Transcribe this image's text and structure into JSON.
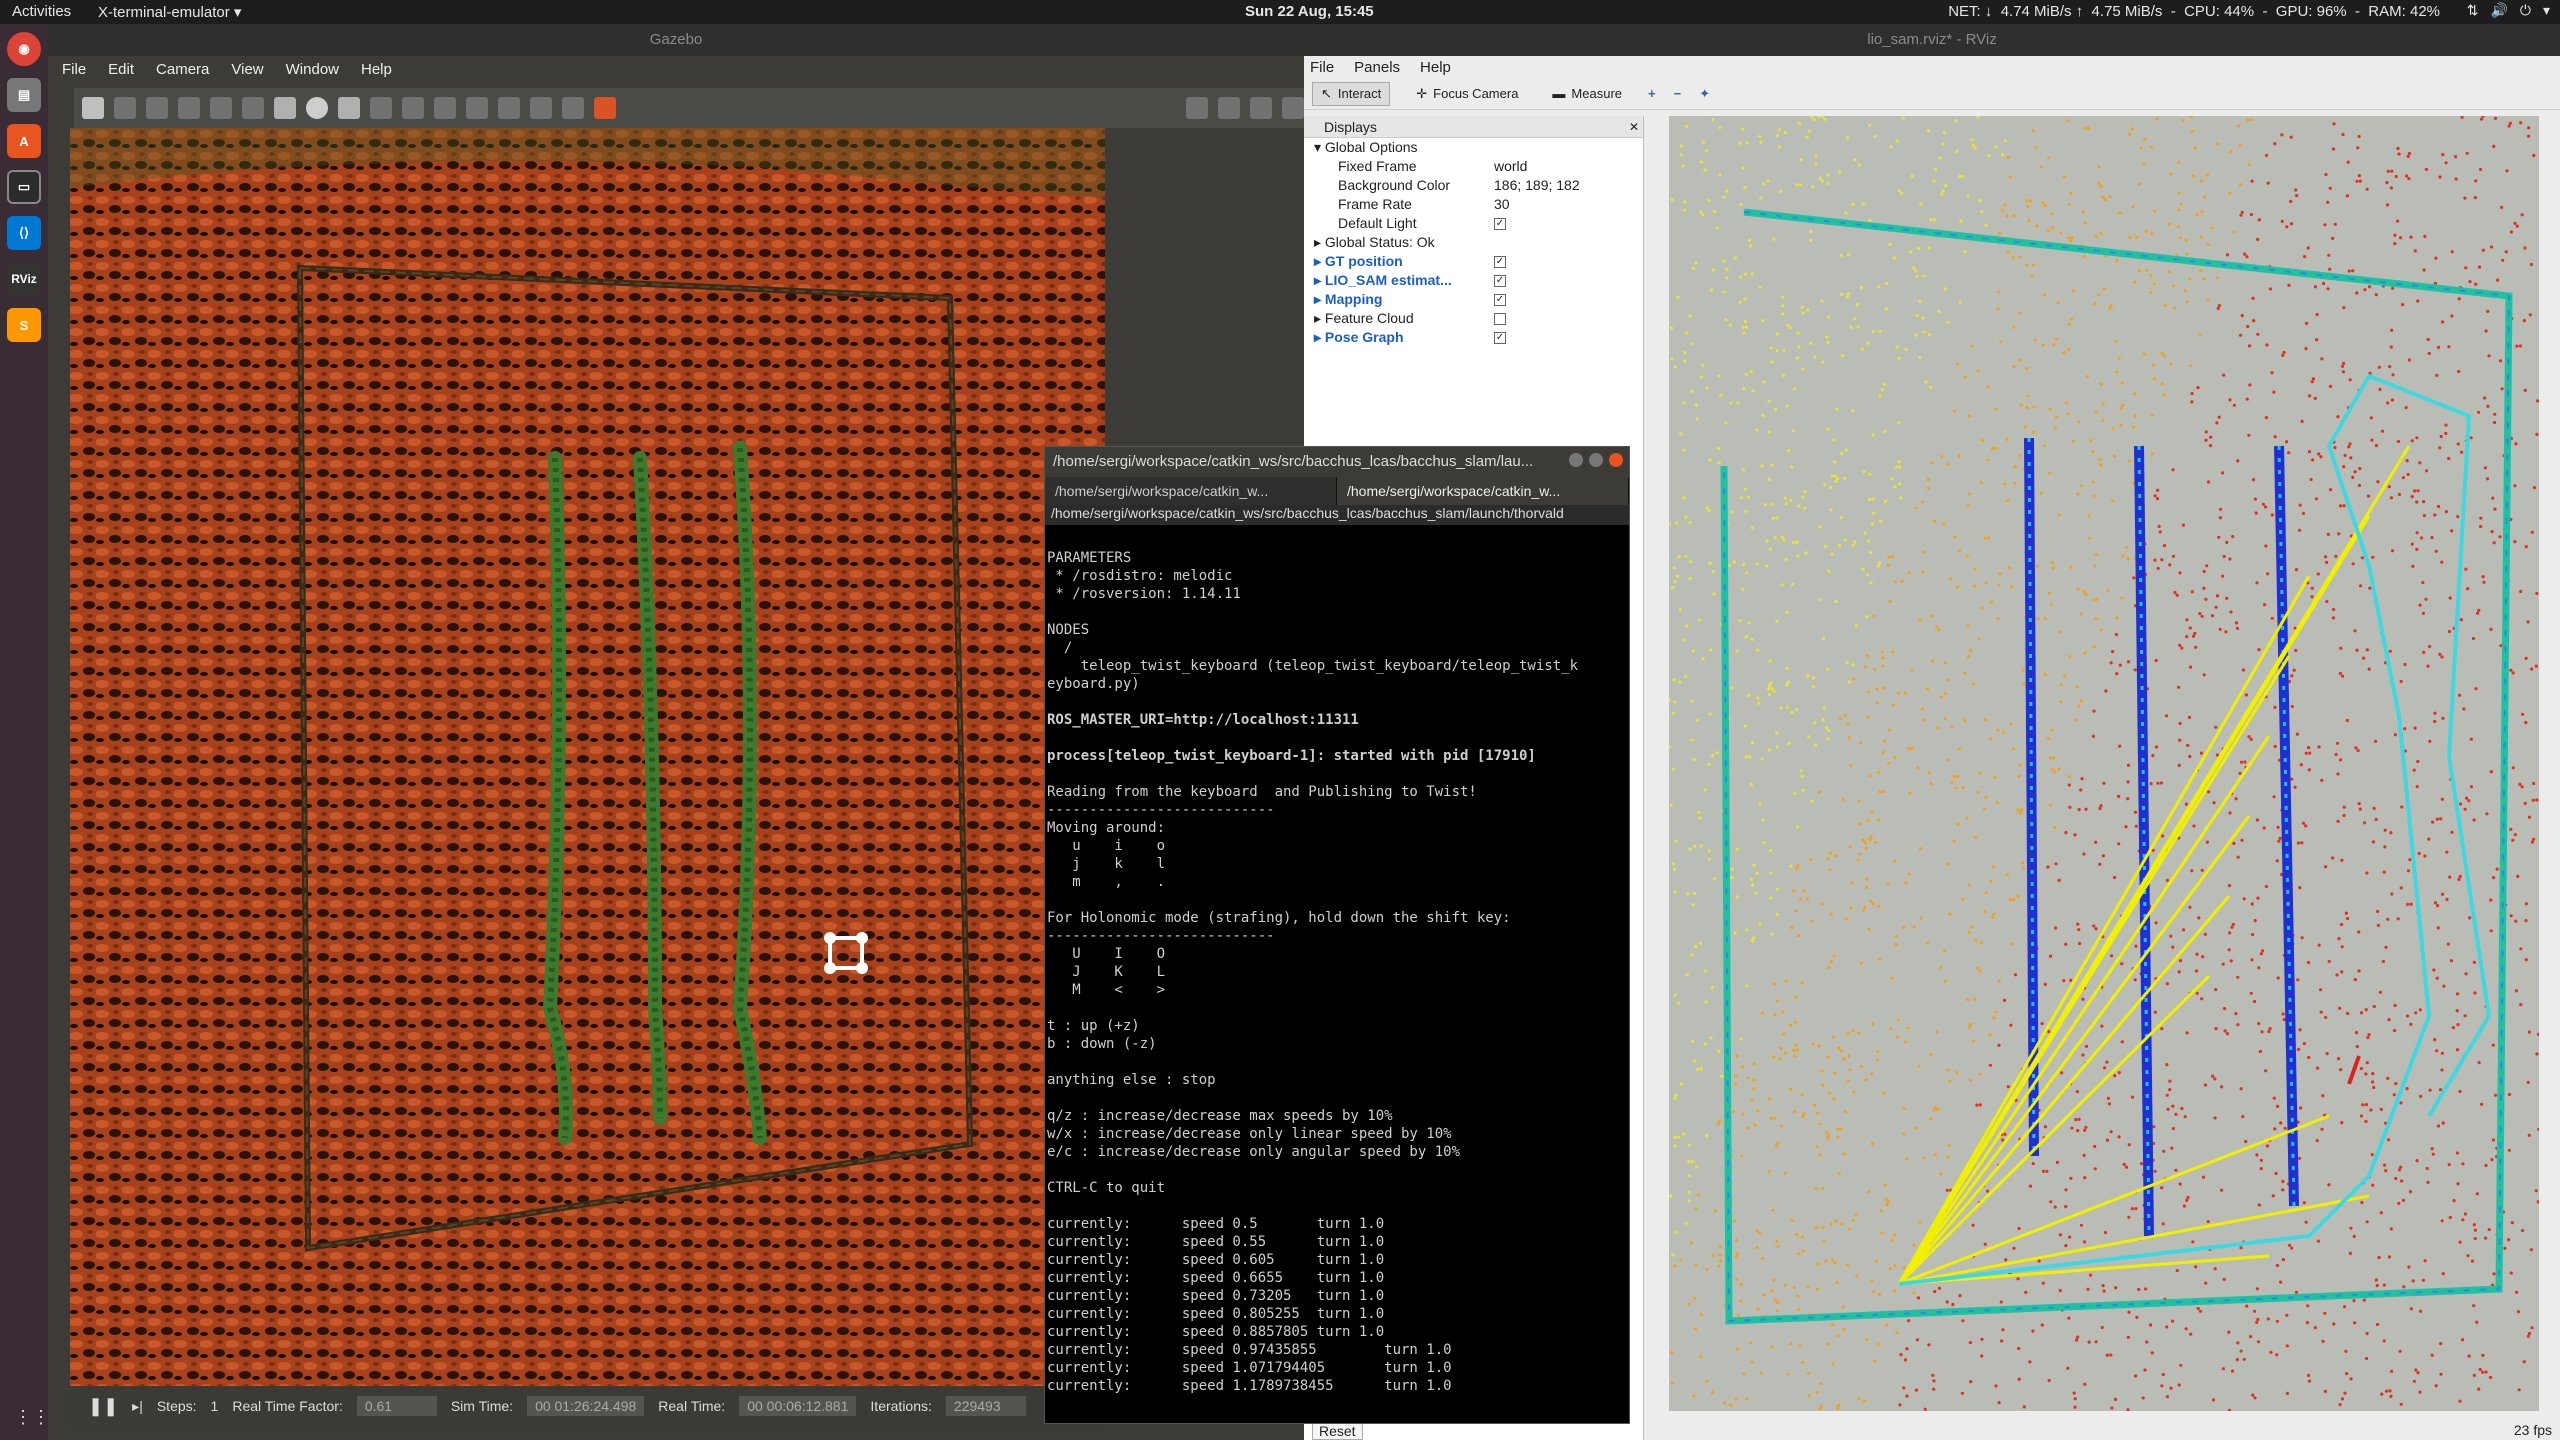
{
  "topbar": {
    "activities": "Activities",
    "app": "X-terminal-emulator ▾",
    "clock": "Sun 22 Aug, 15:45",
    "stats": "NET: ↓  4.74 MiB/s ↑  4.75 MiB/s  -  CPU: 44%  -  GPU: 96%  -  RAM: 42%"
  },
  "dock": {
    "items": [
      "Chrome",
      "Files",
      "Software",
      "Terminal",
      "VS Code",
      "RViz",
      "Sublime"
    ]
  },
  "gazebo": {
    "title": "Gazebo",
    "menu": [
      "File",
      "Edit",
      "Camera",
      "View",
      "Window",
      "Help"
    ],
    "status": {
      "steps_label": "Steps:",
      "steps": "1",
      "rtf_label": "Real Time Factor:",
      "rtf": "0.61",
      "sim_label": "Sim Time:",
      "sim": "00 01:26:24.498",
      "real_label": "Real Time:",
      "real": "00 00:06:12.881",
      "iter_label": "Iterations:",
      "iter": "229493"
    }
  },
  "rviz": {
    "title": "lio_sam.rviz* - RViz",
    "menu": [
      "File",
      "Panels",
      "Help"
    ],
    "tools": [
      "Interact",
      "Focus Camera",
      "Measure"
    ],
    "displays_title": "Displays",
    "props": [
      {
        "name": "Global Options",
        "value": ""
      },
      {
        "name": "Fixed Frame",
        "value": "world"
      },
      {
        "name": "Background Color",
        "value": "186; 189; 182"
      },
      {
        "name": "Frame Rate",
        "value": "30"
      },
      {
        "name": "Default Light",
        "value": "✓"
      },
      {
        "name": "Global Status: Ok",
        "value": ""
      },
      {
        "name": "GT position",
        "value": "✓"
      },
      {
        "name": "LIO_SAM estimat...",
        "value": "✓"
      },
      {
        "name": "Mapping",
        "value": "✓"
      },
      {
        "name": "Feature Cloud",
        "value": ""
      },
      {
        "name": "Pose Graph",
        "value": "✓"
      }
    ],
    "reset": "Reset",
    "fps": "23 fps",
    "bg_color": "#babdb6"
  },
  "terminal": {
    "title": "/home/sergi/workspace/catkin_ws/src/bacchus_lcas/bacchus_slam/lau...",
    "tabs": [
      "/home/sergi/workspace/catkin_w...",
      "/home/sergi/workspace/catkin_w..."
    ],
    "path": "/home/sergi/workspace/catkin_ws/src/bacchus_lcas/bacchus_slam/launch/thorvald",
    "lines": [
      "",
      "PARAMETERS",
      " * /rosdistro: melodic",
      " * /rosversion: 1.14.11",
      "",
      "NODES",
      "  /",
      "    teleop_twist_keyboard (teleop_twist_keyboard/teleop_twist_k",
      "eyboard.py)",
      "",
      "ROS_MASTER_URI=http://localhost:11311",
      "",
      "process[teleop_twist_keyboard-1]: started with pid [17910]",
      "",
      "Reading from the keyboard  and Publishing to Twist!",
      "---------------------------",
      "Moving around:",
      "   u    i    o",
      "   j    k    l",
      "   m    ,    .",
      "",
      "For Holonomic mode (strafing), hold down the shift key:",
      "---------------------------",
      "   U    I    O",
      "   J    K    L",
      "   M    <    >",
      "",
      "t : up (+z)",
      "b : down (-z)",
      "",
      "anything else : stop",
      "",
      "q/z : increase/decrease max speeds by 10%",
      "w/x : increase/decrease only linear speed by 10%",
      "e/c : increase/decrease only angular speed by 10%",
      "",
      "CTRL-C to quit",
      "",
      "currently:      speed 0.5       turn 1.0",
      "currently:      speed 0.55      turn 1.0",
      "currently:      speed 0.605     turn 1.0",
      "currently:      speed 0.6655    turn 1.0",
      "currently:      speed 0.73205   turn 1.0",
      "currently:      speed 0.805255  turn 1.0",
      "currently:      speed 0.8857805 turn 1.0",
      "currently:      speed 0.97435855        turn 1.0",
      "currently:      speed 1.071794405       turn 1.0",
      "currently:      speed 1.1789738455      turn 1.0"
    ]
  }
}
